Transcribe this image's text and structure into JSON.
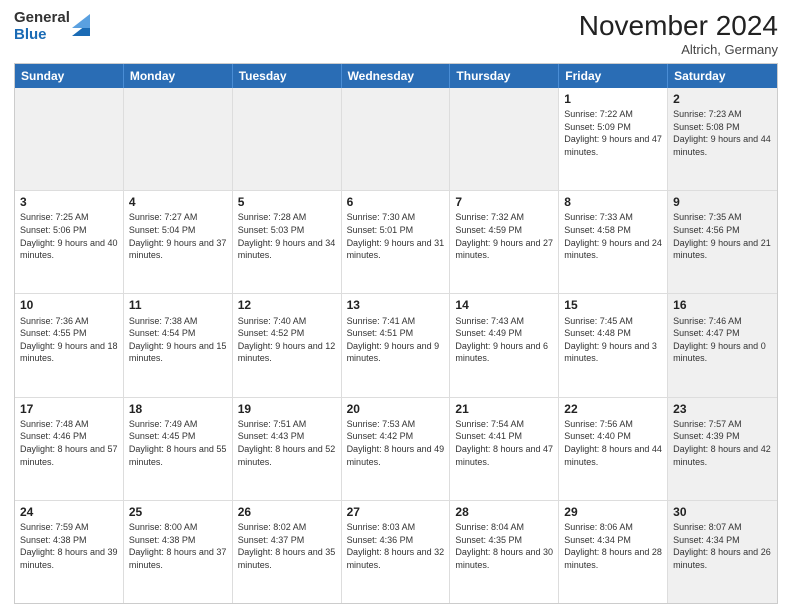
{
  "logo": {
    "general": "General",
    "blue": "Blue"
  },
  "header": {
    "month": "November 2024",
    "location": "Altrich, Germany"
  },
  "weekdays": [
    "Sunday",
    "Monday",
    "Tuesday",
    "Wednesday",
    "Thursday",
    "Friday",
    "Saturday"
  ],
  "rows": [
    [
      {
        "day": "",
        "info": "",
        "shaded": true
      },
      {
        "day": "",
        "info": "",
        "shaded": true
      },
      {
        "day": "",
        "info": "",
        "shaded": true
      },
      {
        "day": "",
        "info": "",
        "shaded": true
      },
      {
        "day": "",
        "info": "",
        "shaded": true
      },
      {
        "day": "1",
        "info": "Sunrise: 7:22 AM\nSunset: 5:09 PM\nDaylight: 9 hours and 47 minutes.",
        "shaded": false
      },
      {
        "day": "2",
        "info": "Sunrise: 7:23 AM\nSunset: 5:08 PM\nDaylight: 9 hours and 44 minutes.",
        "shaded": true
      }
    ],
    [
      {
        "day": "3",
        "info": "Sunrise: 7:25 AM\nSunset: 5:06 PM\nDaylight: 9 hours and 40 minutes.",
        "shaded": false
      },
      {
        "day": "4",
        "info": "Sunrise: 7:27 AM\nSunset: 5:04 PM\nDaylight: 9 hours and 37 minutes.",
        "shaded": false
      },
      {
        "day": "5",
        "info": "Sunrise: 7:28 AM\nSunset: 5:03 PM\nDaylight: 9 hours and 34 minutes.",
        "shaded": false
      },
      {
        "day": "6",
        "info": "Sunrise: 7:30 AM\nSunset: 5:01 PM\nDaylight: 9 hours and 31 minutes.",
        "shaded": false
      },
      {
        "day": "7",
        "info": "Sunrise: 7:32 AM\nSunset: 4:59 PM\nDaylight: 9 hours and 27 minutes.",
        "shaded": false
      },
      {
        "day": "8",
        "info": "Sunrise: 7:33 AM\nSunset: 4:58 PM\nDaylight: 9 hours and 24 minutes.",
        "shaded": false
      },
      {
        "day": "9",
        "info": "Sunrise: 7:35 AM\nSunset: 4:56 PM\nDaylight: 9 hours and 21 minutes.",
        "shaded": true
      }
    ],
    [
      {
        "day": "10",
        "info": "Sunrise: 7:36 AM\nSunset: 4:55 PM\nDaylight: 9 hours and 18 minutes.",
        "shaded": false
      },
      {
        "day": "11",
        "info": "Sunrise: 7:38 AM\nSunset: 4:54 PM\nDaylight: 9 hours and 15 minutes.",
        "shaded": false
      },
      {
        "day": "12",
        "info": "Sunrise: 7:40 AM\nSunset: 4:52 PM\nDaylight: 9 hours and 12 minutes.",
        "shaded": false
      },
      {
        "day": "13",
        "info": "Sunrise: 7:41 AM\nSunset: 4:51 PM\nDaylight: 9 hours and 9 minutes.",
        "shaded": false
      },
      {
        "day": "14",
        "info": "Sunrise: 7:43 AM\nSunset: 4:49 PM\nDaylight: 9 hours and 6 minutes.",
        "shaded": false
      },
      {
        "day": "15",
        "info": "Sunrise: 7:45 AM\nSunset: 4:48 PM\nDaylight: 9 hours and 3 minutes.",
        "shaded": false
      },
      {
        "day": "16",
        "info": "Sunrise: 7:46 AM\nSunset: 4:47 PM\nDaylight: 9 hours and 0 minutes.",
        "shaded": true
      }
    ],
    [
      {
        "day": "17",
        "info": "Sunrise: 7:48 AM\nSunset: 4:46 PM\nDaylight: 8 hours and 57 minutes.",
        "shaded": false
      },
      {
        "day": "18",
        "info": "Sunrise: 7:49 AM\nSunset: 4:45 PM\nDaylight: 8 hours and 55 minutes.",
        "shaded": false
      },
      {
        "day": "19",
        "info": "Sunrise: 7:51 AM\nSunset: 4:43 PM\nDaylight: 8 hours and 52 minutes.",
        "shaded": false
      },
      {
        "day": "20",
        "info": "Sunrise: 7:53 AM\nSunset: 4:42 PM\nDaylight: 8 hours and 49 minutes.",
        "shaded": false
      },
      {
        "day": "21",
        "info": "Sunrise: 7:54 AM\nSunset: 4:41 PM\nDaylight: 8 hours and 47 minutes.",
        "shaded": false
      },
      {
        "day": "22",
        "info": "Sunrise: 7:56 AM\nSunset: 4:40 PM\nDaylight: 8 hours and 44 minutes.",
        "shaded": false
      },
      {
        "day": "23",
        "info": "Sunrise: 7:57 AM\nSunset: 4:39 PM\nDaylight: 8 hours and 42 minutes.",
        "shaded": true
      }
    ],
    [
      {
        "day": "24",
        "info": "Sunrise: 7:59 AM\nSunset: 4:38 PM\nDaylight: 8 hours and 39 minutes.",
        "shaded": false
      },
      {
        "day": "25",
        "info": "Sunrise: 8:00 AM\nSunset: 4:38 PM\nDaylight: 8 hours and 37 minutes.",
        "shaded": false
      },
      {
        "day": "26",
        "info": "Sunrise: 8:02 AM\nSunset: 4:37 PM\nDaylight: 8 hours and 35 minutes.",
        "shaded": false
      },
      {
        "day": "27",
        "info": "Sunrise: 8:03 AM\nSunset: 4:36 PM\nDaylight: 8 hours and 32 minutes.",
        "shaded": false
      },
      {
        "day": "28",
        "info": "Sunrise: 8:04 AM\nSunset: 4:35 PM\nDaylight: 8 hours and 30 minutes.",
        "shaded": false
      },
      {
        "day": "29",
        "info": "Sunrise: 8:06 AM\nSunset: 4:34 PM\nDaylight: 8 hours and 28 minutes.",
        "shaded": false
      },
      {
        "day": "30",
        "info": "Sunrise: 8:07 AM\nSunset: 4:34 PM\nDaylight: 8 hours and 26 minutes.",
        "shaded": true
      }
    ]
  ]
}
